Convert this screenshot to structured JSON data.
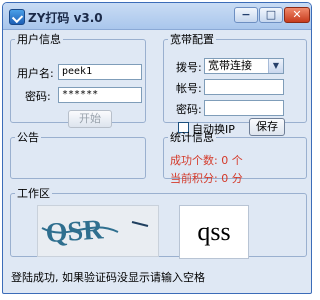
{
  "window": {
    "title": "ZY打码  v3.0",
    "controls": {
      "minimize": "−",
      "maximize": "□",
      "close": "✕"
    }
  },
  "user_info": {
    "legend": "用户信息",
    "username_label": "用户名:",
    "username_value": "peek1",
    "password_label": "密码:",
    "password_value": "******",
    "start_button": "开始"
  },
  "broadband": {
    "legend": "宽带配置",
    "dial_label": "拨号:",
    "dial_value": "宽带连接",
    "account_label": "帐号:",
    "account_value": "",
    "password_label": "密码:",
    "password_value": "",
    "auto_ip_label": "自动换IP",
    "auto_ip_checked": false,
    "save_button": "保存"
  },
  "notice": {
    "legend": "公告"
  },
  "stats": {
    "legend": "统计信息",
    "success_text": "成功个数: 0 个",
    "score_text": "当前积分: 0 分"
  },
  "work_area": {
    "legend": "工作区",
    "captcha_text": "QSR",
    "result_text": "qss"
  },
  "status": {
    "message": "登陆成功, 如果验证码没显示请输入空格"
  },
  "colors": {
    "stat_text": "#d43a2a",
    "title_gradient": "#a9c6ec",
    "window_bg": "#dfe8f4"
  }
}
